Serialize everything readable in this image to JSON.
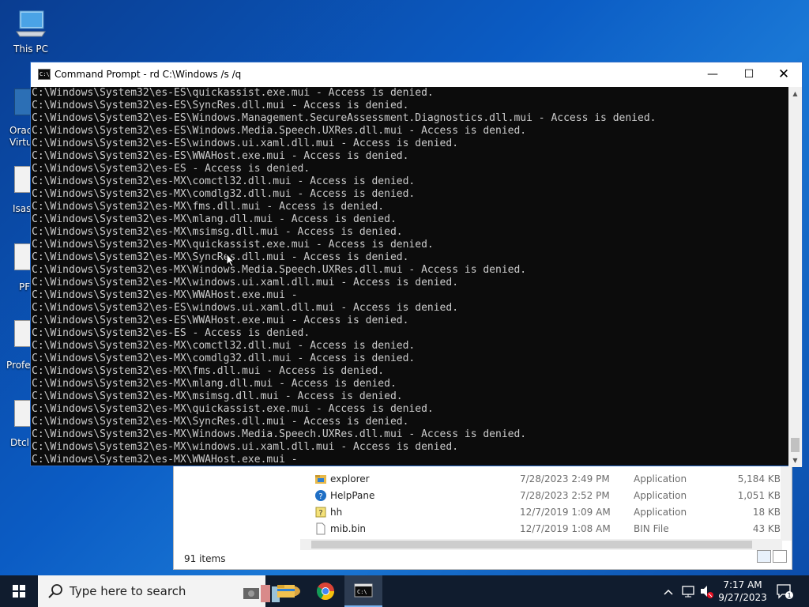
{
  "desktop": {
    "icons": [
      {
        "label": "This PC"
      }
    ],
    "partial_labels": [
      "Oracl",
      "Virtu",
      "Isas",
      "PF",
      "Profes",
      "Dtcl"
    ]
  },
  "explorer": {
    "files": [
      {
        "name": "explorer",
        "date": "7/28/2023 2:49 PM",
        "type": "Application",
        "size": "5,184 KB",
        "icon": "folder-app-icon"
      },
      {
        "name": "HelpPane",
        "date": "7/28/2023 2:52 PM",
        "type": "Application",
        "size": "1,051 KB",
        "icon": "help-icon"
      },
      {
        "name": "hh",
        "date": "12/7/2019 1:09 AM",
        "type": "Application",
        "size": "18 KB",
        "icon": "help-book-icon"
      },
      {
        "name": "mib.bin",
        "date": "12/7/2019 1:08 AM",
        "type": "BIN File",
        "size": "43 KB",
        "icon": "file-icon"
      }
    ],
    "status": "91 items"
  },
  "cmd": {
    "title": "Command Prompt - rd  C:\\Windows /s /q",
    "lines": [
      "C:\\Windows\\System32\\es-ES\\quickassist.exe.mui - Access is denied.",
      "C:\\Windows\\System32\\es-ES\\SyncRes.dll.mui - Access is denied.",
      "C:\\Windows\\System32\\es-ES\\Windows.Management.SecureAssessment.Diagnostics.dll.mui - Access is denied.",
      "C:\\Windows\\System32\\es-ES\\Windows.Media.Speech.UXRes.dll.mui - Access is denied.",
      "C:\\Windows\\System32\\es-ES\\windows.ui.xaml.dll.mui - Access is denied.",
      "C:\\Windows\\System32\\es-ES\\WWAHost.exe.mui - Access is denied.",
      "C:\\Windows\\System32\\es-ES - Access is denied.",
      "C:\\Windows\\System32\\es-MX\\comctl32.dll.mui - Access is denied.",
      "C:\\Windows\\System32\\es-MX\\comdlg32.dll.mui - Access is denied.",
      "C:\\Windows\\System32\\es-MX\\fms.dll.mui - Access is denied.",
      "C:\\Windows\\System32\\es-MX\\mlang.dll.mui - Access is denied.",
      "C:\\Windows\\System32\\es-MX\\msimsg.dll.mui - Access is denied.",
      "C:\\Windows\\System32\\es-MX\\quickassist.exe.mui - Access is denied.",
      "C:\\Windows\\System32\\es-MX\\SyncRes.dll.mui - Access is denied.",
      "C:\\Windows\\System32\\es-MX\\Windows.Media.Speech.UXRes.dll.mui - Access is denied.",
      "C:\\Windows\\System32\\es-MX\\windows.ui.xaml.dll.mui - Access is denied.",
      "C:\\Windows\\System32\\es-MX\\WWAHost.exe.mui -",
      "C:\\Windows\\System32\\es-ES\\windows.ui.xaml.dll.mui - Access is denied.",
      "C:\\Windows\\System32\\es-ES\\WWAHost.exe.mui - Access is denied.",
      "C:\\Windows\\System32\\es-ES - Access is denied.",
      "C:\\Windows\\System32\\es-MX\\comctl32.dll.mui - Access is denied.",
      "C:\\Windows\\System32\\es-MX\\comdlg32.dll.mui - Access is denied.",
      "C:\\Windows\\System32\\es-MX\\fms.dll.mui - Access is denied.",
      "C:\\Windows\\System32\\es-MX\\mlang.dll.mui - Access is denied.",
      "C:\\Windows\\System32\\es-MX\\msimsg.dll.mui - Access is denied.",
      "C:\\Windows\\System32\\es-MX\\quickassist.exe.mui - Access is denied.",
      "C:\\Windows\\System32\\es-MX\\SyncRes.dll.mui - Access is denied.",
      "C:\\Windows\\System32\\es-MX\\Windows.Media.Speech.UXRes.dll.mui - Access is denied.",
      "C:\\Windows\\System32\\es-MX\\windows.ui.xaml.dll.mui - Access is denied.",
      "C:\\Windows\\System32\\es-MX\\WWAHost.exe.mui -"
    ]
  },
  "taskbar": {
    "search_placeholder": "Type here to search",
    "time": "7:17 AM",
    "date": "9/27/2023",
    "notification_count": "1"
  },
  "colors": {
    "accent": "#2b6bc7",
    "taskbar": "#101c2e",
    "console_bg": "#0c0c0c",
    "console_fg": "#cccccc"
  }
}
